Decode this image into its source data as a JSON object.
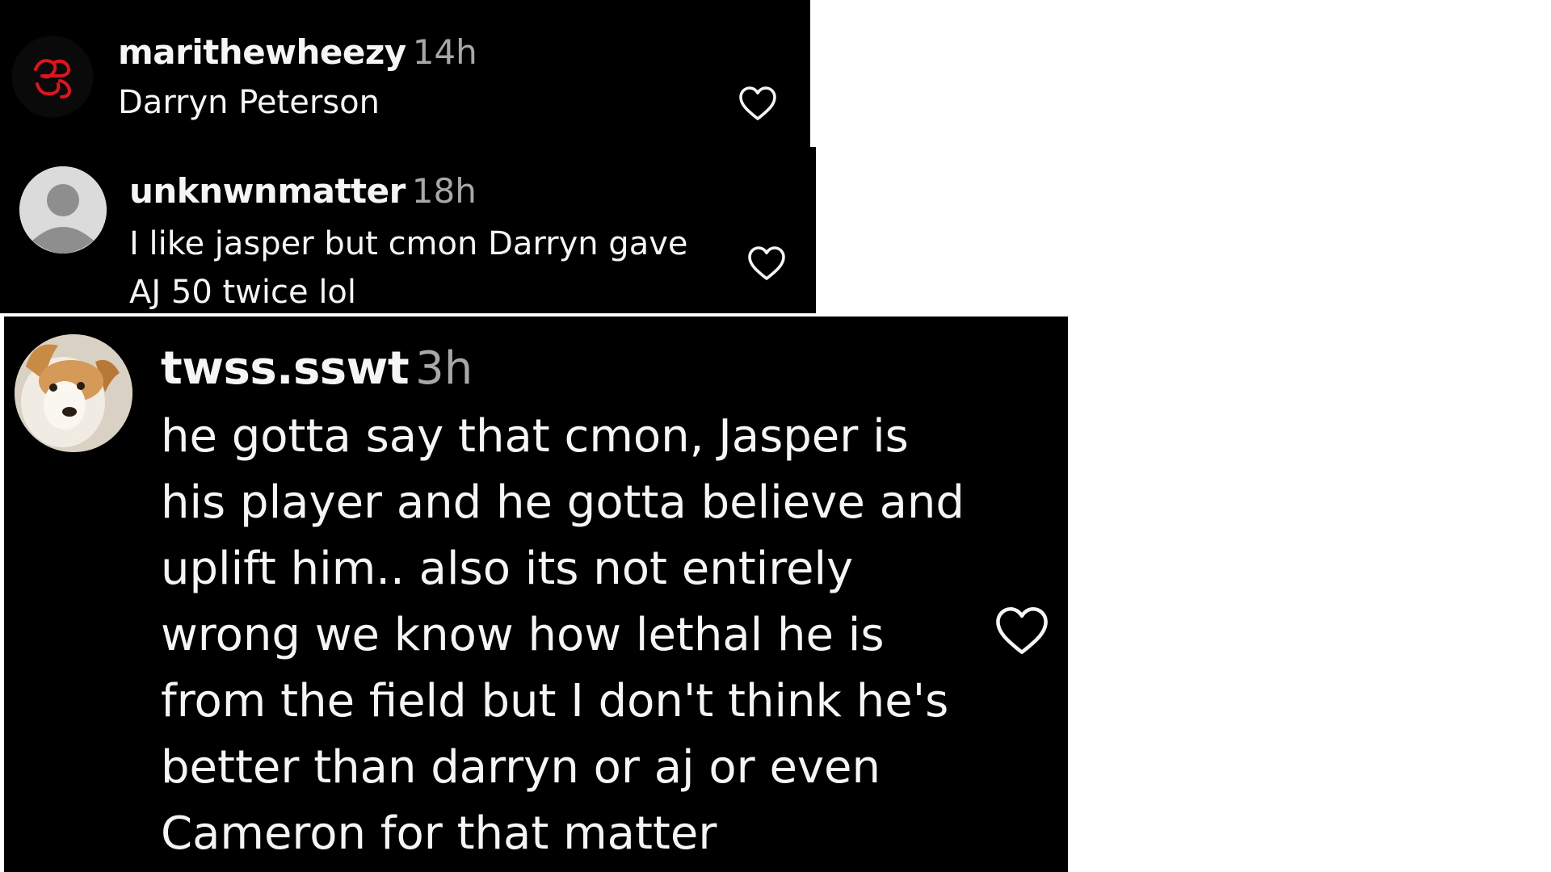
{
  "comments": [
    {
      "username": "marithewheezy",
      "timestamp": "14h",
      "text": "Darryn Peterson",
      "avatar_icon": "red-logo-avatar",
      "like_icon": "heart-outline-icon"
    },
    {
      "username": "unknwnmatter",
      "timestamp": "18h",
      "text": "I like jasper but cmon Darryn gave AJ 50 twice lol",
      "avatar_icon": "default-user-avatar",
      "like_icon": "heart-outline-icon"
    },
    {
      "username": "twss.sswt",
      "timestamp": "3h",
      "text": "he gotta say that cmon, Jasper is his player and he gotta believe and uplift him.. also its not entirely wrong we know how lethal he is from the field but I don't think he's better than darryn or aj or even Cameron for that matter",
      "avatar_icon": "dog-photo-avatar",
      "like_icon": "heart-outline-icon"
    }
  ],
  "colors": {
    "background": "#000000",
    "username": "#f5f5f5",
    "timestamp": "#a8a8a8",
    "logo_red": "#e0141e"
  }
}
